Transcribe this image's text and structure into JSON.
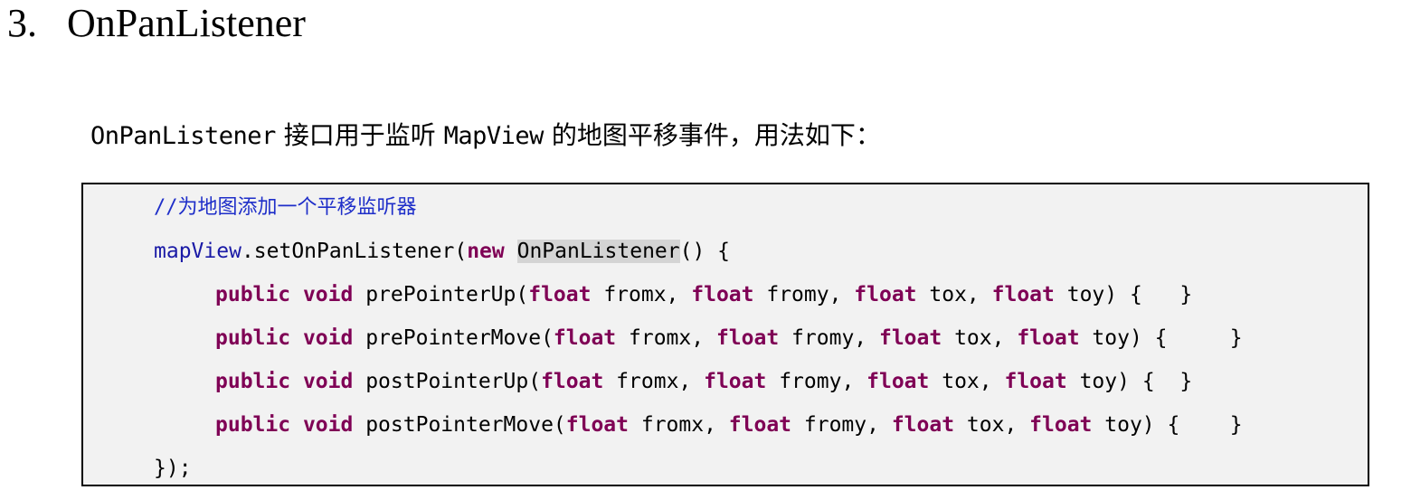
{
  "section": {
    "number": "3.",
    "title": "OnPanListener"
  },
  "intro": {
    "class_name": "OnPanListener",
    "text_part1": " 接口用于监听 ",
    "view_name": "MapView",
    "text_part2": " 的地图平移事件，用法如下："
  },
  "code": {
    "comment_prefix": "//",
    "comment_text": "为地图添加一个平移监听器",
    "line2": {
      "receiver": "mapView",
      "call": ".setOnPanListener(",
      "kw_new": "new",
      "type": "OnPanListener",
      "tail": "() {"
    },
    "methods": [
      {
        "kw_public": "public",
        "kw_void": "void",
        "name": "prePointerUp(",
        "p1_type": "float",
        "p1_name": " fromx, ",
        "p2_type": "float",
        "p2_name": " fromy, ",
        "p3_type": "float",
        "p3_name": " tox, ",
        "p4_type": "float",
        "p4_name": " toy) {   }"
      },
      {
        "kw_public": "public",
        "kw_void": "void",
        "name": "prePointerMove(",
        "p1_type": "float",
        "p1_name": " fromx, ",
        "p2_type": "float",
        "p2_name": " fromy, ",
        "p3_type": "float",
        "p3_name": " tox, ",
        "p4_type": "float",
        "p4_name": " toy) {     }"
      },
      {
        "kw_public": "public",
        "kw_void": "void",
        "name": "postPointerUp(",
        "p1_type": "float",
        "p1_name": " fromx, ",
        "p2_type": "float",
        "p2_name": " fromy, ",
        "p3_type": "float",
        "p3_name": " tox, ",
        "p4_type": "float",
        "p4_name": " toy) {  }"
      },
      {
        "kw_public": "public",
        "kw_void": "void",
        "name": "postPointerMove(",
        "p1_type": "float",
        "p1_name": " fromx, ",
        "p2_type": "float",
        "p2_name": " fromy, ",
        "p3_type": "float",
        "p3_name": " tox, ",
        "p4_type": "float",
        "p4_name": " toy) {    }"
      }
    ],
    "closing": "});"
  },
  "colors": {
    "keyword": "#7f0055",
    "comment": "#1f2fc9",
    "identifier": "#1a1aa6",
    "code_background": "#f2f2f2",
    "selection_highlight": "#d4d4d4"
  }
}
